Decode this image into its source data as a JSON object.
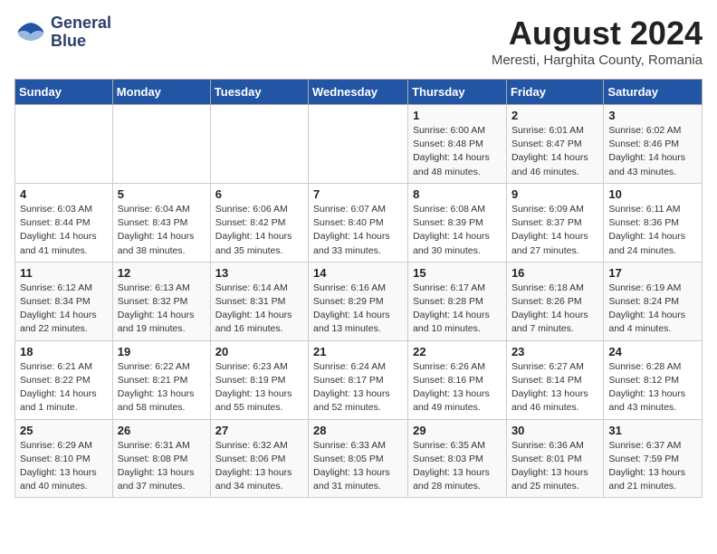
{
  "header": {
    "logo_line1": "General",
    "logo_line2": "Blue",
    "month_year": "August 2024",
    "location": "Meresti, Harghita County, Romania"
  },
  "days_of_week": [
    "Sunday",
    "Monday",
    "Tuesday",
    "Wednesday",
    "Thursday",
    "Friday",
    "Saturday"
  ],
  "weeks": [
    [
      {
        "day": "",
        "info": ""
      },
      {
        "day": "",
        "info": ""
      },
      {
        "day": "",
        "info": ""
      },
      {
        "day": "",
        "info": ""
      },
      {
        "day": "1",
        "info": "Sunrise: 6:00 AM\nSunset: 8:48 PM\nDaylight: 14 hours and 48 minutes."
      },
      {
        "day": "2",
        "info": "Sunrise: 6:01 AM\nSunset: 8:47 PM\nDaylight: 14 hours and 46 minutes."
      },
      {
        "day": "3",
        "info": "Sunrise: 6:02 AM\nSunset: 8:46 PM\nDaylight: 14 hours and 43 minutes."
      }
    ],
    [
      {
        "day": "4",
        "info": "Sunrise: 6:03 AM\nSunset: 8:44 PM\nDaylight: 14 hours and 41 minutes."
      },
      {
        "day": "5",
        "info": "Sunrise: 6:04 AM\nSunset: 8:43 PM\nDaylight: 14 hours and 38 minutes."
      },
      {
        "day": "6",
        "info": "Sunrise: 6:06 AM\nSunset: 8:42 PM\nDaylight: 14 hours and 35 minutes."
      },
      {
        "day": "7",
        "info": "Sunrise: 6:07 AM\nSunset: 8:40 PM\nDaylight: 14 hours and 33 minutes."
      },
      {
        "day": "8",
        "info": "Sunrise: 6:08 AM\nSunset: 8:39 PM\nDaylight: 14 hours and 30 minutes."
      },
      {
        "day": "9",
        "info": "Sunrise: 6:09 AM\nSunset: 8:37 PM\nDaylight: 14 hours and 27 minutes."
      },
      {
        "day": "10",
        "info": "Sunrise: 6:11 AM\nSunset: 8:36 PM\nDaylight: 14 hours and 24 minutes."
      }
    ],
    [
      {
        "day": "11",
        "info": "Sunrise: 6:12 AM\nSunset: 8:34 PM\nDaylight: 14 hours and 22 minutes."
      },
      {
        "day": "12",
        "info": "Sunrise: 6:13 AM\nSunset: 8:32 PM\nDaylight: 14 hours and 19 minutes."
      },
      {
        "day": "13",
        "info": "Sunrise: 6:14 AM\nSunset: 8:31 PM\nDaylight: 14 hours and 16 minutes."
      },
      {
        "day": "14",
        "info": "Sunrise: 6:16 AM\nSunset: 8:29 PM\nDaylight: 14 hours and 13 minutes."
      },
      {
        "day": "15",
        "info": "Sunrise: 6:17 AM\nSunset: 8:28 PM\nDaylight: 14 hours and 10 minutes."
      },
      {
        "day": "16",
        "info": "Sunrise: 6:18 AM\nSunset: 8:26 PM\nDaylight: 14 hours and 7 minutes."
      },
      {
        "day": "17",
        "info": "Sunrise: 6:19 AM\nSunset: 8:24 PM\nDaylight: 14 hours and 4 minutes."
      }
    ],
    [
      {
        "day": "18",
        "info": "Sunrise: 6:21 AM\nSunset: 8:22 PM\nDaylight: 14 hours and 1 minute."
      },
      {
        "day": "19",
        "info": "Sunrise: 6:22 AM\nSunset: 8:21 PM\nDaylight: 13 hours and 58 minutes."
      },
      {
        "day": "20",
        "info": "Sunrise: 6:23 AM\nSunset: 8:19 PM\nDaylight: 13 hours and 55 minutes."
      },
      {
        "day": "21",
        "info": "Sunrise: 6:24 AM\nSunset: 8:17 PM\nDaylight: 13 hours and 52 minutes."
      },
      {
        "day": "22",
        "info": "Sunrise: 6:26 AM\nSunset: 8:16 PM\nDaylight: 13 hours and 49 minutes."
      },
      {
        "day": "23",
        "info": "Sunrise: 6:27 AM\nSunset: 8:14 PM\nDaylight: 13 hours and 46 minutes."
      },
      {
        "day": "24",
        "info": "Sunrise: 6:28 AM\nSunset: 8:12 PM\nDaylight: 13 hours and 43 minutes."
      }
    ],
    [
      {
        "day": "25",
        "info": "Sunrise: 6:29 AM\nSunset: 8:10 PM\nDaylight: 13 hours and 40 minutes."
      },
      {
        "day": "26",
        "info": "Sunrise: 6:31 AM\nSunset: 8:08 PM\nDaylight: 13 hours and 37 minutes."
      },
      {
        "day": "27",
        "info": "Sunrise: 6:32 AM\nSunset: 8:06 PM\nDaylight: 13 hours and 34 minutes."
      },
      {
        "day": "28",
        "info": "Sunrise: 6:33 AM\nSunset: 8:05 PM\nDaylight: 13 hours and 31 minutes."
      },
      {
        "day": "29",
        "info": "Sunrise: 6:35 AM\nSunset: 8:03 PM\nDaylight: 13 hours and 28 minutes."
      },
      {
        "day": "30",
        "info": "Sunrise: 6:36 AM\nSunset: 8:01 PM\nDaylight: 13 hours and 25 minutes."
      },
      {
        "day": "31",
        "info": "Sunrise: 6:37 AM\nSunset: 7:59 PM\nDaylight: 13 hours and 21 minutes."
      }
    ]
  ]
}
